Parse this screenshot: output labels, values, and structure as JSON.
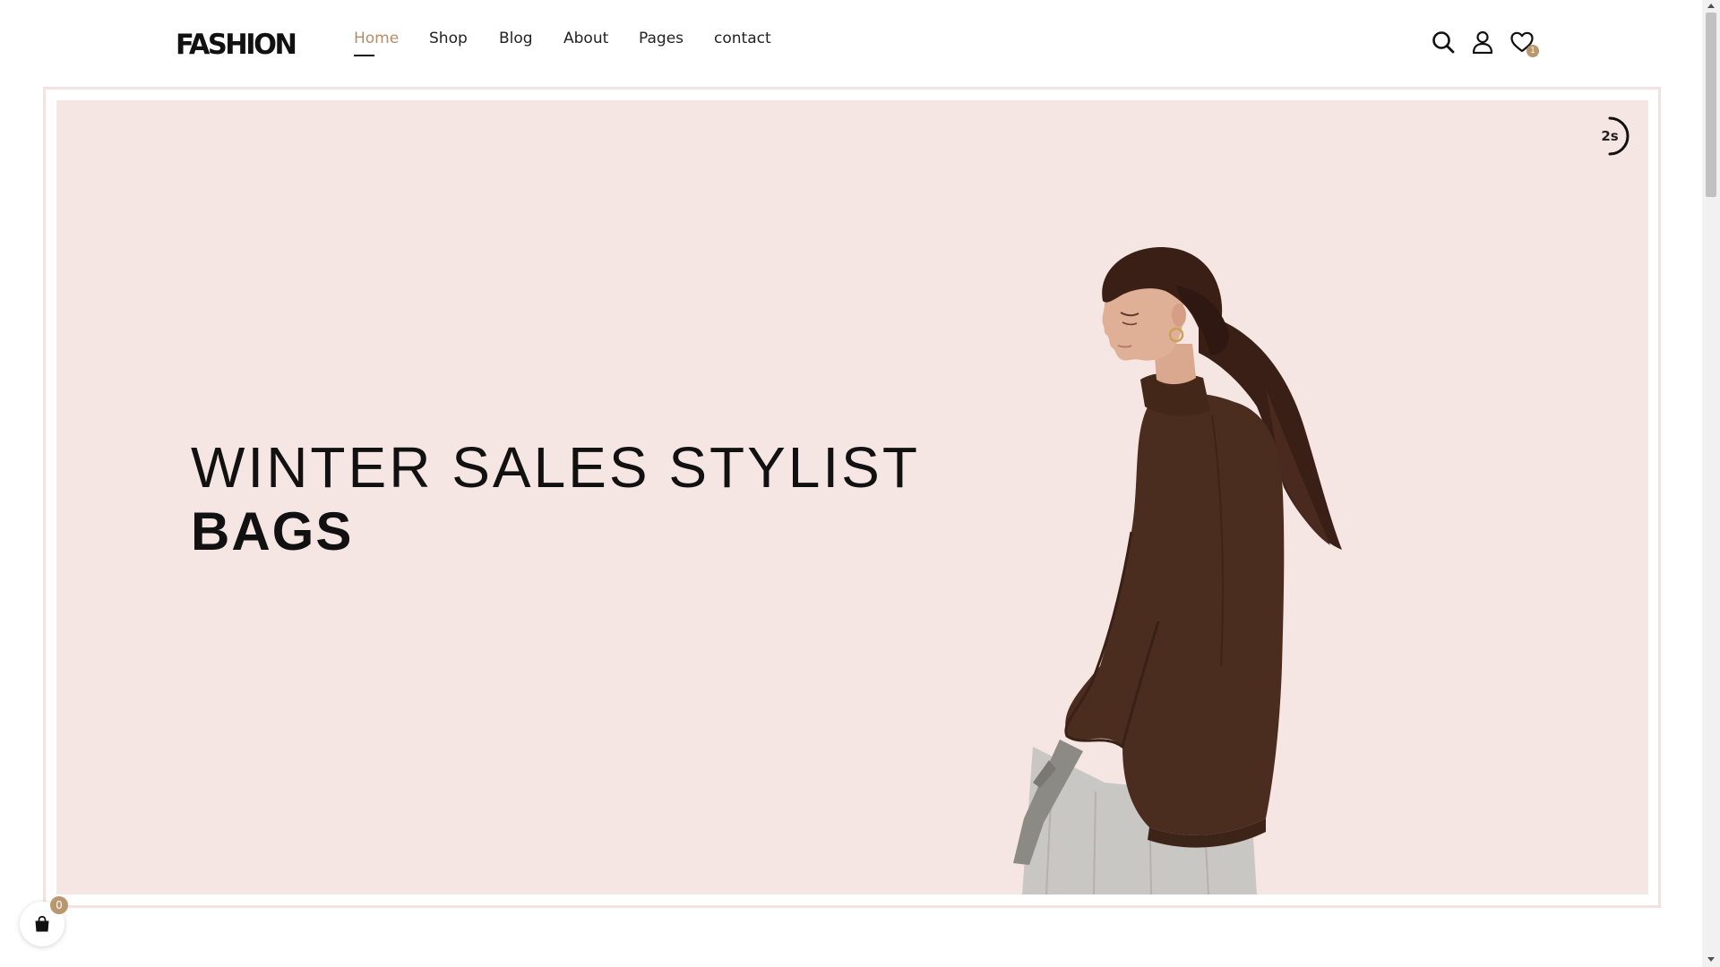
{
  "brand": {
    "logo_text": "FASHION"
  },
  "nav": {
    "items": [
      {
        "label": "Home",
        "active": true
      },
      {
        "label": "Shop",
        "active": false
      },
      {
        "label": "Blog",
        "active": false
      },
      {
        "label": "About",
        "active": false
      },
      {
        "label": "Pages",
        "active": false
      },
      {
        "label": "contact",
        "active": false
      }
    ]
  },
  "header_icons": {
    "search": "search-icon",
    "account": "user-icon",
    "wishlist": "heart-icon",
    "wishlist_count": "1"
  },
  "hero": {
    "title_line1": "WINTER SALES STYLIST",
    "title_line2": "BAGS",
    "slide_timer": "2s",
    "background_color": "#f5e6e3"
  },
  "floating_cart": {
    "icon": "shopping-bag-icon",
    "count": "0"
  },
  "colors": {
    "accent": "#b08e6b",
    "badge": "#b9976f",
    "text": "#111111"
  }
}
